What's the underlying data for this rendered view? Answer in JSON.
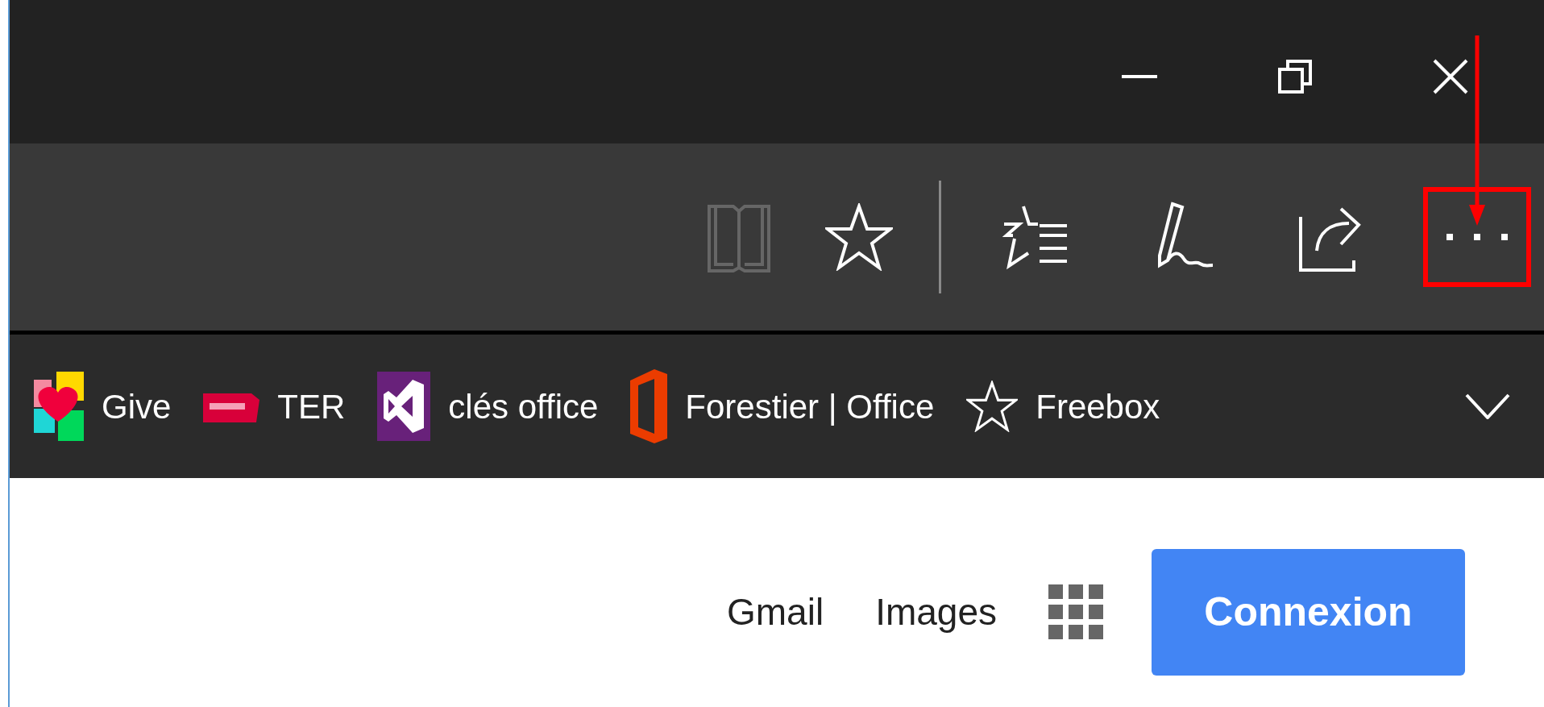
{
  "window_controls": [
    {
      "kind": "minimize"
    },
    {
      "kind": "restore"
    },
    {
      "kind": "close"
    }
  ],
  "toolbar": [
    {
      "kind": "reading",
      "disabled": true,
      "highlighted": false
    },
    {
      "kind": "favorite",
      "disabled": false,
      "highlighted": false
    },
    {
      "kind": "hub",
      "disabled": false,
      "highlighted": false
    },
    {
      "kind": "notes",
      "disabled": false,
      "highlighted": false
    },
    {
      "kind": "share",
      "disabled": false,
      "highlighted": false
    },
    {
      "kind": "more",
      "disabled": false,
      "highlighted": true
    }
  ],
  "favorites_bar": [
    {
      "kind": "give",
      "label": "Give"
    },
    {
      "kind": "sncf",
      "label": "TER"
    },
    {
      "kind": "vs",
      "label": "clés office"
    },
    {
      "kind": "office",
      "label": "Forestier | Office"
    },
    {
      "kind": "star",
      "label": "Freebox"
    }
  ],
  "page": {
    "links": [
      "Gmail",
      "Images"
    ],
    "button": "Connexion"
  }
}
